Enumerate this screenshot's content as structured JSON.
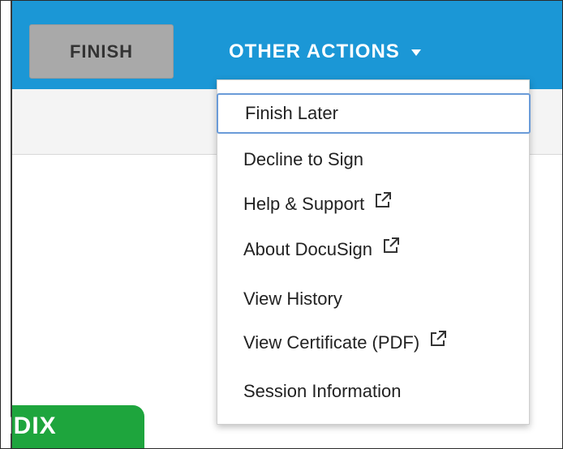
{
  "toolbar": {
    "finish_label": "FINISH",
    "other_actions_label": "OTHER ACTIONS",
    "colors": {
      "toolbar_bg": "#1b97d6",
      "finish_bg": "#a9a9a9",
      "focus_ring": "#6a9bd8"
    }
  },
  "menu": {
    "items": [
      {
        "label": "Finish Later",
        "external": false,
        "focused": true
      },
      {
        "label": "Decline to Sign",
        "external": false,
        "focused": false
      },
      {
        "label": "Help & Support",
        "external": true,
        "icon": "external-link-icon"
      },
      {
        "label": "About DocuSign",
        "external": true,
        "icon": "external-link-icon"
      },
      {
        "label": "View History",
        "external": false
      },
      {
        "label": "View Certificate (PDF)",
        "external": true,
        "icon": "external-link-icon"
      },
      {
        "label": "Session Information",
        "external": false
      }
    ]
  },
  "document": {
    "tab_label": "NDIX",
    "tab_color": "#1ea53d"
  }
}
